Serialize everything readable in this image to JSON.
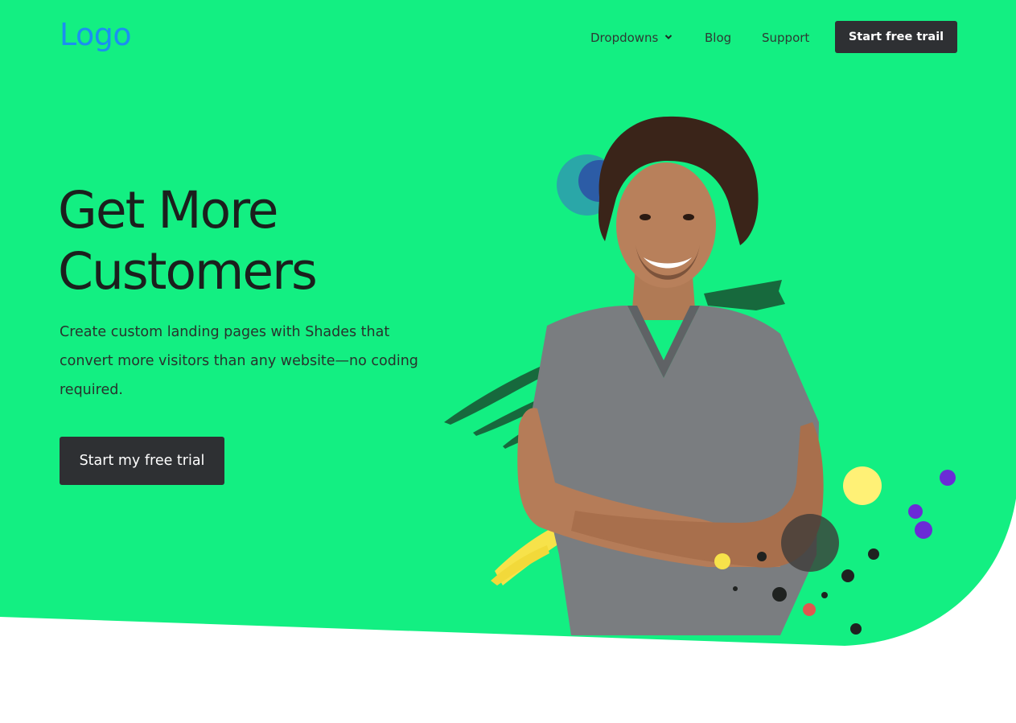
{
  "brand": {
    "logo_text": "Logo",
    "logo_color": "#1b8ff1"
  },
  "nav": {
    "items": [
      {
        "label": "Dropdowns",
        "has_dropdown": true,
        "icon": "chevron-down-icon"
      },
      {
        "label": "Blog"
      },
      {
        "label": "Support"
      }
    ],
    "cta_label": "Start free trail"
  },
  "hero": {
    "title_line1": "Get More",
    "title_line2": "Customers",
    "subtitle": "Create custom landing pages with Shades that convert more visitors than any website—no coding required.",
    "cta_label": "Start my free trial",
    "image": "smiling-man-arms-crossed-photo"
  },
  "colors": {
    "hero_background": "#13ef82",
    "page_background": "#ffffff",
    "button_dark": "#2e3033",
    "headline_text": "#1b1f1d"
  }
}
